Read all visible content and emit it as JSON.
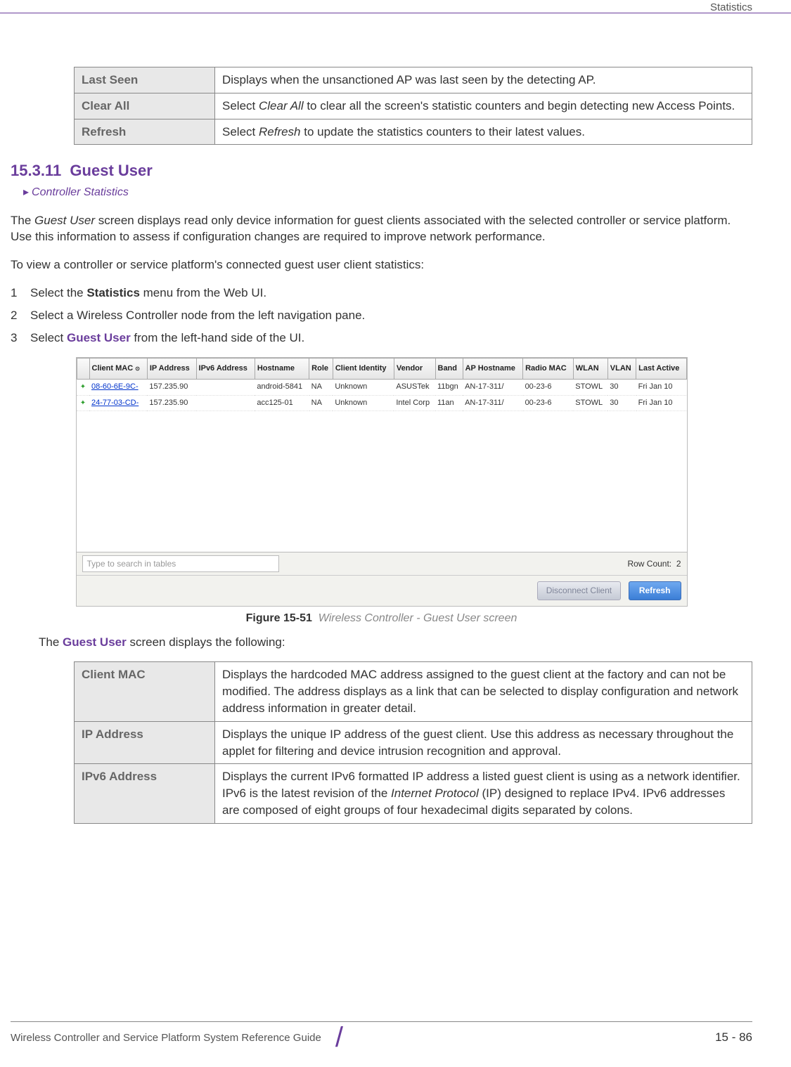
{
  "header": {
    "section_label": "Statistics"
  },
  "table_top": {
    "rows": [
      {
        "label": "Last Seen",
        "desc": "Displays when the unsanctioned AP was last seen by the detecting AP."
      },
      {
        "label": "Clear All",
        "desc_prefix": "Select ",
        "desc_italic": "Clear All",
        "desc_suffix": " to clear all the screen's statistic counters and begin detecting new Access Points."
      },
      {
        "label": "Refresh",
        "desc_prefix": "Select ",
        "desc_italic": "Refresh",
        "desc_suffix": " to update the statistics counters to their latest values."
      }
    ]
  },
  "section": {
    "number": "15.3.11",
    "title": "Guest User",
    "breadcrumb": "Controller Statistics"
  },
  "para1_a": "The ",
  "para1_em": "Guest User",
  "para1_b": " screen displays read only device information for guest clients associated with the selected controller or service platform. Use this information to assess if configuration changes are required to improve network performance.",
  "para2": "To view a controller or service platform's connected guest user client statistics:",
  "steps": [
    {
      "n": "1",
      "pre": "Select the ",
      "bold": "Statistics",
      "post": " menu from the Web UI."
    },
    {
      "n": "2",
      "pre": "Select a Wireless Controller node from the left navigation pane.",
      "bold": "",
      "post": ""
    },
    {
      "n": "3",
      "pre": "Select ",
      "bold": "Guest User",
      "post": " from the left-hand side of the UI."
    }
  ],
  "screenshot": {
    "columns": [
      "",
      "Client MAC",
      "IP Address",
      "IPv6 Address",
      "Hostname",
      "Role",
      "Client Identity",
      "Vendor",
      "Band",
      "AP Hostname",
      "Radio MAC",
      "WLAN",
      "VLAN",
      "Last Active"
    ],
    "rows": [
      {
        "mac": "08-60-6E-9C-",
        "ip": "157.235.90",
        "ipv6": "",
        "host": "android-5841",
        "role": "NA",
        "ident": "Unknown",
        "vendor": "ASUSTek",
        "band": "11bgn",
        "aphost": "AN-17-311/",
        "radio": "00-23-6",
        "wlan": "STOWL",
        "vlan": "30",
        "last": "Fri Jan 10"
      },
      {
        "mac": "24-77-03-CD-",
        "ip": "157.235.90",
        "ipv6": "",
        "host": "acc125-01",
        "role": "NA",
        "ident": "Unknown",
        "vendor": "Intel Corp",
        "band": "11an",
        "aphost": "AN-17-311/",
        "radio": "00-23-6",
        "wlan": "STOWL",
        "vlan": "30",
        "last": "Fri Jan 10"
      }
    ],
    "search_placeholder": "Type to search in tables",
    "row_count_label": "Row Count:",
    "row_count": "2",
    "disconnect_btn": "Disconnect Client",
    "refresh_btn": "Refresh"
  },
  "figure": {
    "num": "Figure 15-51",
    "title": "Wireless Controller - Guest User screen"
  },
  "after_fig_pre": "The ",
  "after_fig_bold": "Guest User",
  "after_fig_post": " screen displays the following:",
  "table_bottom": {
    "rows": [
      {
        "label": "Client MAC",
        "desc": "Displays the hardcoded MAC address assigned to the guest client at the factory and can not be modified. The address displays as a link that can be selected to display configuration and network address information in greater detail."
      },
      {
        "label": "IP Address",
        "desc": "Displays the unique IP address of the guest client. Use this address as necessary throughout the applet for filtering and device intrusion recognition and approval."
      },
      {
        "label": "IPv6 Address",
        "desc_pre": "Displays the current IPv6 formatted IP address a listed guest client is using as a network identifier. IPv6 is the latest revision of the ",
        "desc_em": "Internet Protocol",
        "desc_post": " (IP) designed to replace IPv4. IPv6 addresses are composed of eight groups of four hexadecimal digits separated by colons."
      }
    ]
  },
  "footer": {
    "guide": "Wireless Controller and Service Platform System Reference Guide",
    "page": "15 - 86"
  }
}
